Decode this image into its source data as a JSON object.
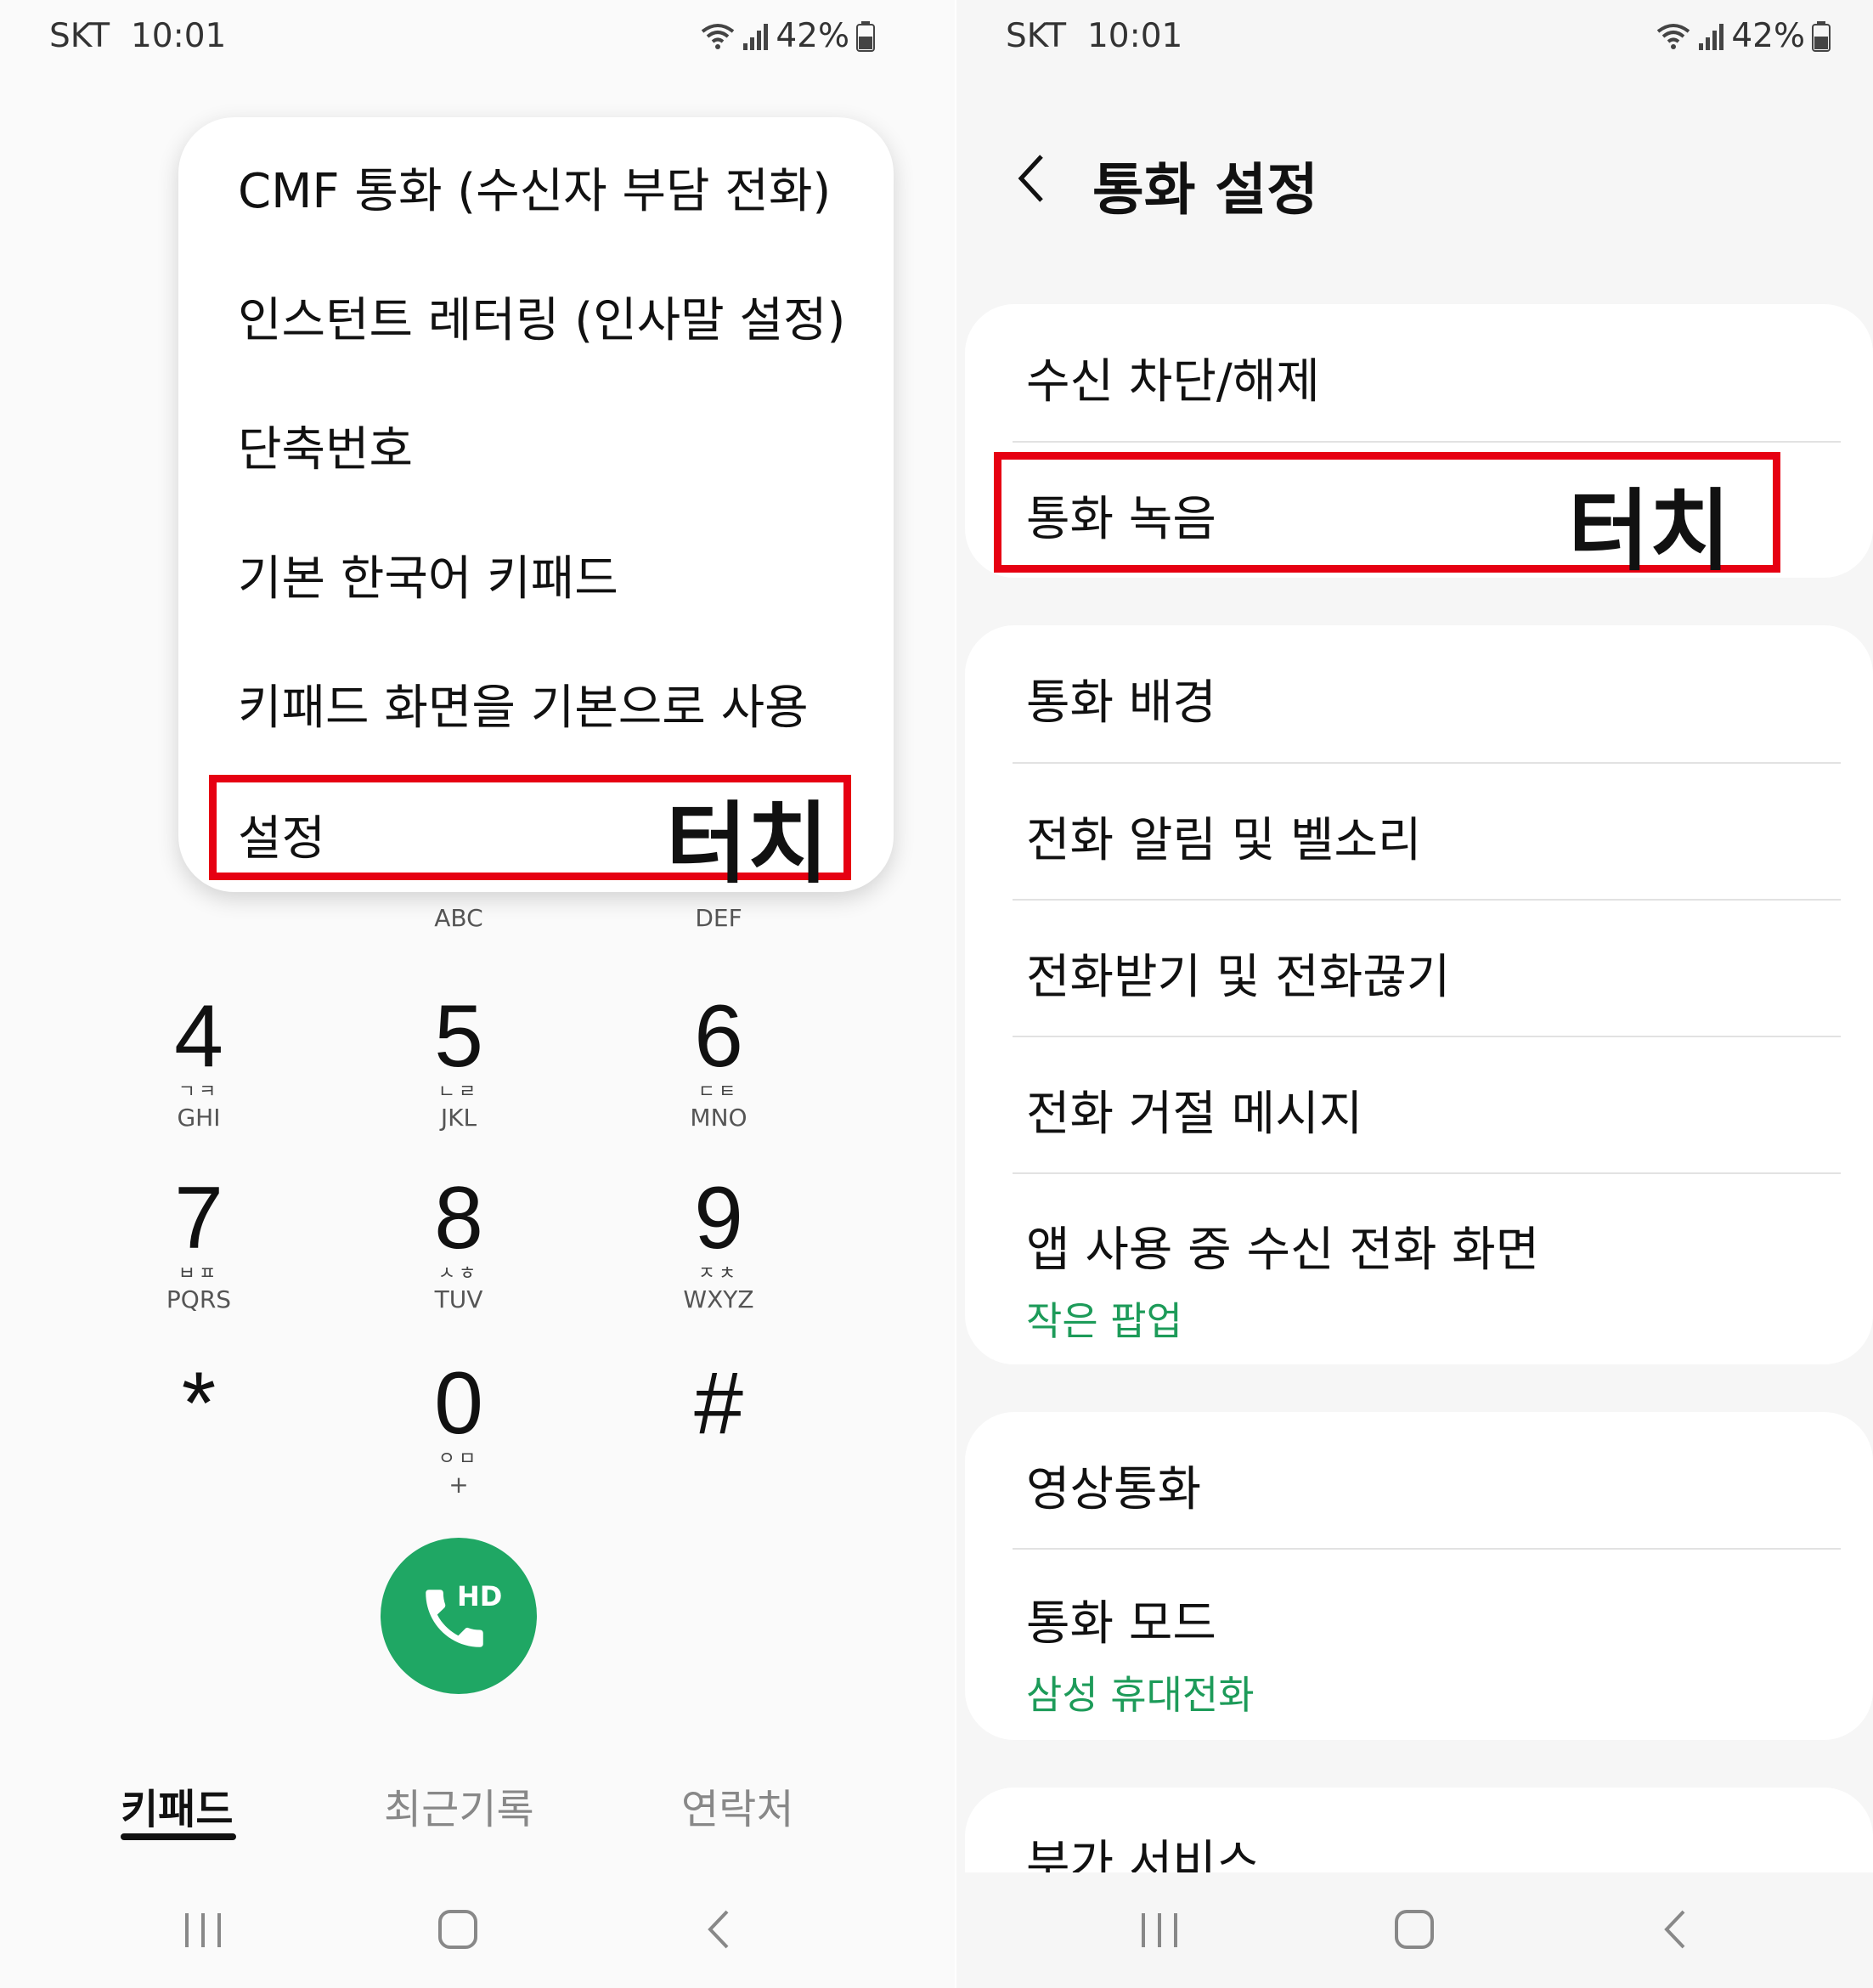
{
  "left": {
    "status": {
      "carrier": "SKT",
      "time": "10:01",
      "battery": "42%"
    },
    "menu": {
      "items": [
        "CMF 통화 (수신자 부담 전화)",
        "인스턴트 레터링 (인사말 설정)",
        "단축번호",
        "기본 한국어 키패드",
        "키패드 화면을 기본으로 사용",
        "설정"
      ],
      "touch_label": "터치"
    },
    "keypad": {
      "top_row_sub": [
        "ABC",
        "DEF"
      ],
      "keys": [
        {
          "digit": "4",
          "kor": "ㄱㅋ",
          "eng": "GHI"
        },
        {
          "digit": "5",
          "kor": "ㄴㄹ",
          "eng": "JKL"
        },
        {
          "digit": "6",
          "kor": "ㄷㅌ",
          "eng": "MNO"
        },
        {
          "digit": "7",
          "kor": "ㅂㅍ",
          "eng": "PQRS"
        },
        {
          "digit": "8",
          "kor": "ㅅㅎ",
          "eng": "TUV"
        },
        {
          "digit": "9",
          "kor": "ㅈㅊ",
          "eng": "WXYZ"
        },
        {
          "digit": "*",
          "kor": "",
          "eng": ""
        },
        {
          "digit": "0",
          "kor": "ㅇㅁ",
          "eng": "+"
        },
        {
          "digit": "#",
          "kor": "",
          "eng": ""
        }
      ],
      "call_badge": "HD",
      "call_color": "#1fa764"
    },
    "tabs": [
      "키패드",
      "최근기록",
      "연락처"
    ]
  },
  "right": {
    "status": {
      "carrier": "SKT",
      "time": "10:01",
      "battery": "42%"
    },
    "title": "통화 설정",
    "card1": [
      "수신 차단/해제",
      "통화 녹음"
    ],
    "touch_label": "터치",
    "card2": [
      {
        "label": "통화 배경"
      },
      {
        "label": "전화 알림 및 벨소리"
      },
      {
        "label": "전화받기 및 전화끊기"
      },
      {
        "label": "전화 거절 메시지"
      },
      {
        "label": "앱 사용 중 수신 전화 화면",
        "sub": "작은 팝업"
      }
    ],
    "card3": [
      {
        "label": "영상통화"
      },
      {
        "label": "통화 모드",
        "sub": "삼성 휴대전화"
      }
    ],
    "card4": [
      {
        "label": "부가 서비스"
      }
    ],
    "accent": "#1d9b59",
    "highlight_color": "#e60012"
  }
}
